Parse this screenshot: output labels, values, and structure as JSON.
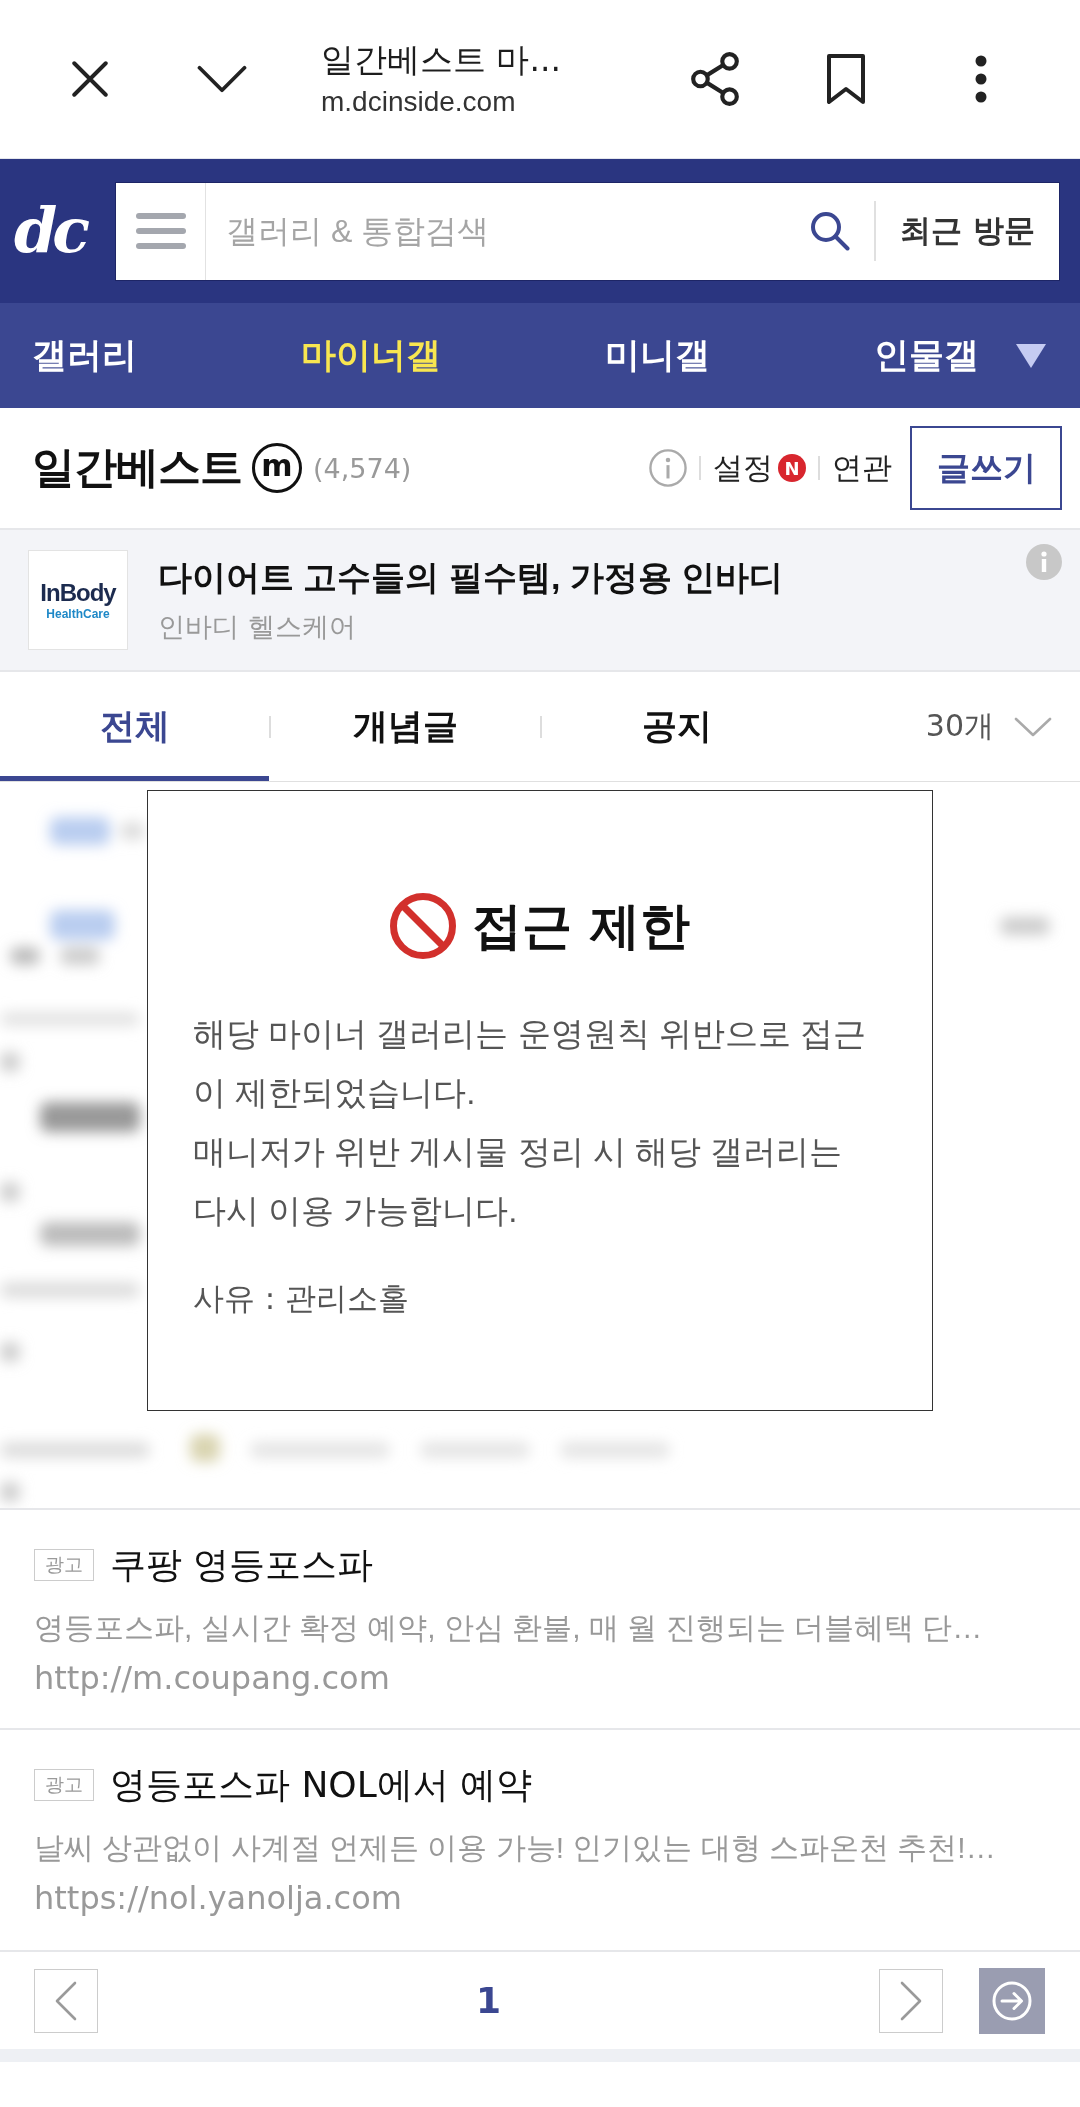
{
  "browser_bar": {
    "title": "일간베스트 마...",
    "url": "m.dcinside.com"
  },
  "header": {
    "logo": "dc",
    "search": {
      "placeholder": "갤러리 & 통합검색"
    },
    "recent_button": "최근 방문"
  },
  "nav": [
    {
      "label": "갤러리",
      "selected": false
    },
    {
      "label": "마이너갤",
      "selected": true
    },
    {
      "label": "미니갤",
      "selected": false
    },
    {
      "label": "인물갤",
      "selected": false
    }
  ],
  "gallery": {
    "title": "일간베스트",
    "type_badge": "m",
    "count": "(4,574)",
    "links": [
      {
        "label": "설정",
        "new_badge": "N"
      },
      {
        "label": "연관"
      }
    ],
    "write_button": "글쓰기"
  },
  "banner_ad": {
    "logo": {
      "wordmark": "InBody",
      "subtitle": "HealthCare"
    },
    "title": "다이어트 고수들의 필수템, 가정용 인바디",
    "advertiser": "인바디 헬스케어"
  },
  "tabs": [
    {
      "label": "전체",
      "selected": true
    },
    {
      "label": "개념글",
      "selected": false
    },
    {
      "label": "공지",
      "selected": false
    }
  ],
  "page_size": "30개",
  "notice": {
    "title": "접근 제한",
    "paragraphs": [
      "해당 마이너 갤러리는 운영원칙 위반으로 접근이 제한되었습니다.",
      "매니저가 위반 게시물 정리 시 해당 갤러리는 다시 이용 가능합니다."
    ],
    "reason": "사유 : 관리소홀"
  },
  "text_ads": [
    {
      "tag": "광고",
      "title": "쿠팡 영등포스파",
      "description": "영등포스파, 실시간 확정 예약, 안심 환불, 매 월 진행되는 더블혜택 단…",
      "url": "http://m.coupang.com"
    },
    {
      "tag": "광고",
      "title": "영등포스파 NOL에서 예약",
      "description": "날씨 상관없이 사계절 언제든 이용 가능! 인기있는 대형 스파온천 추천!…",
      "url": "https://nol.yanolja.com"
    }
  ],
  "pagination": {
    "current": "1"
  }
}
